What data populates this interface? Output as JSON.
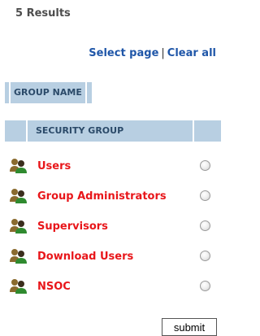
{
  "results": {
    "count_text": "5 Results"
  },
  "actions": {
    "select_page": "Select page",
    "separator": "|",
    "clear_all": "Clear all"
  },
  "column_header": {
    "label": "GROUP NAME"
  },
  "table": {
    "header": {
      "column_title": "SECURITY GROUP"
    },
    "rows": [
      {
        "name": "Users",
        "icon": "users-group-icon",
        "selected": false
      },
      {
        "name": "Group Administrators",
        "icon": "users-group-icon",
        "selected": false
      },
      {
        "name": "Supervisors",
        "icon": "users-group-icon",
        "selected": false
      },
      {
        "name": "Download Users",
        "icon": "users-group-icon",
        "selected": false
      },
      {
        "name": "NSOC",
        "icon": "users-group-icon",
        "selected": false
      }
    ]
  },
  "form": {
    "submit_label": "submit"
  },
  "colors": {
    "link": "#1f56a8",
    "group_name": "#e8161a",
    "header_bar": "#b8cfe2",
    "header_text": "#2b4a69"
  }
}
